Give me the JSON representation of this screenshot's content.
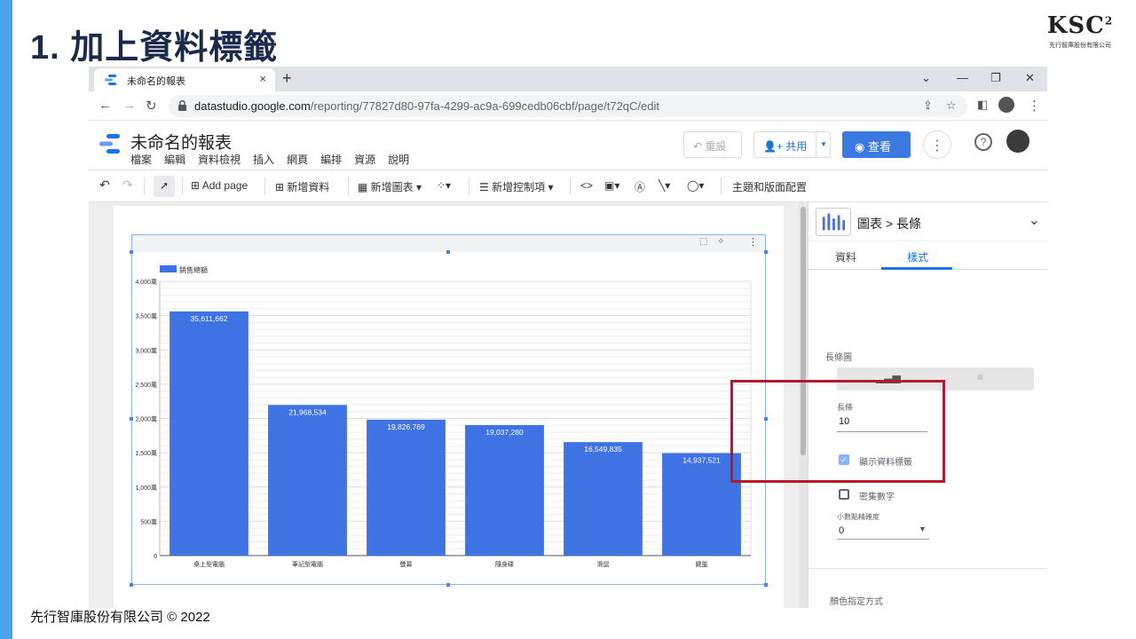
{
  "slide": {
    "title": "1. 加上資料標籤",
    "logo_mark": "KSC",
    "logo_sup": "2",
    "logo_sub": "先行智庫股份有限公司",
    "footer": "先行智庫股份有限公司 © 2022"
  },
  "browser": {
    "tab_title": "未命名的報表",
    "tab_close": "×",
    "new_tab": "+",
    "url_host": "datastudio.google.com",
    "url_path": "/reporting/77827d80-97fa-4299-ac9a-699cedb06cbf/page/t72qC/edit"
  },
  "ds": {
    "report_title": "未命名的報表",
    "menu": [
      "檔案",
      "編輯",
      "資料檢視",
      "插入",
      "網頁",
      "編排",
      "資源",
      "說明"
    ],
    "reset_label": "重設",
    "share_label": "共用",
    "view_label": "查看"
  },
  "toolbar": {
    "add_page": "Add page",
    "add_data": "新增資料",
    "add_chart": "新增圖表",
    "add_control": "新增控制項",
    "theme_layout": "主題和版面配置"
  },
  "panel": {
    "breadcrumb": "圖表 > 長條",
    "tab_data": "資料",
    "tab_style": "樣式",
    "bar_chart_label": "長條圖",
    "bars_label": "長條",
    "bars_value": "10",
    "show_data_labels": "顯示資料標籤",
    "show_data_labels_checked": true,
    "compact_numbers": "密集數字",
    "compact_numbers_checked": false,
    "decimal_precision_label": "小數點精確度",
    "decimal_precision_value": "0",
    "color_method_label": "顏色指定方式"
  },
  "colors": {
    "bar": "#3f72e2",
    "accent": "#1a73e8",
    "highlight": "#b7192a"
  },
  "chart_data": {
    "type": "bar",
    "legend": "銷售總額",
    "categories": [
      "桌上型電腦",
      "筆記型電腦",
      "螢幕",
      "隨身碟",
      "滑鼠",
      "鍵盤"
    ],
    "values": [
      35611662,
      21968534,
      19826769,
      19037280,
      16549835,
      14937521
    ],
    "data_labels": [
      "35,611,662",
      "21,968,534",
      "19,826,769",
      "19,037,280",
      "16,549,835",
      "14,937,521"
    ],
    "y_ticks": [
      "0",
      "500萬",
      "1,000萬",
      "1,500萬",
      "2,000萬",
      "2,500萬",
      "3,000萬",
      "3,500萬",
      "4,000萬"
    ],
    "ylim": [
      0,
      40000000
    ],
    "grid": true,
    "legend_position": "top-left"
  }
}
